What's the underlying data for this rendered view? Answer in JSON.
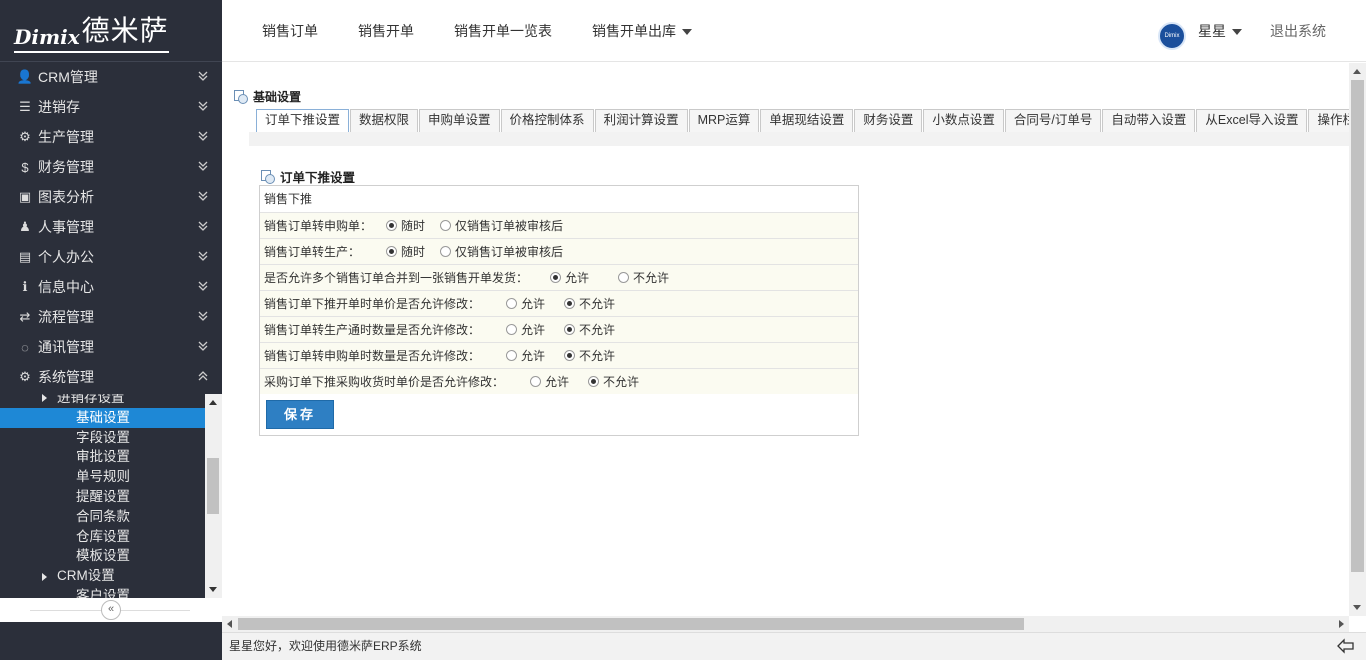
{
  "app": {
    "logo_latin": "Dimix",
    "logo_cn": "德米萨"
  },
  "sidebar": {
    "items": [
      {
        "label": "CRM管理",
        "icon": "user-icon",
        "glyph": "👤"
      },
      {
        "label": "进销存",
        "icon": "list-icon",
        "glyph": "☰"
      },
      {
        "label": "生产管理",
        "icon": "gears-icon",
        "glyph": "⚙"
      },
      {
        "label": "财务管理",
        "icon": "dollar-icon",
        "glyph": "$"
      },
      {
        "label": "图表分析",
        "icon": "picture-icon",
        "glyph": "▣"
      },
      {
        "label": "人事管理",
        "icon": "sitemap-icon",
        "glyph": "♟"
      },
      {
        "label": "个人办公",
        "icon": "briefcase-icon",
        "glyph": "▤"
      },
      {
        "label": "信息中心",
        "icon": "info-icon",
        "glyph": "ℹ"
      },
      {
        "label": "流程管理",
        "icon": "exchange-icon",
        "glyph": "⇄"
      },
      {
        "label": "通讯管理",
        "icon": "comment-icon",
        "glyph": "◌"
      },
      {
        "label": "系统管理",
        "icon": "cog-icon",
        "glyph": "⚙"
      }
    ],
    "submenu": [
      {
        "label": "进销存设置",
        "type": "group"
      },
      {
        "label": "基础设置",
        "type": "leaf",
        "selected": true
      },
      {
        "label": "字段设置",
        "type": "leaf"
      },
      {
        "label": "审批设置",
        "type": "leaf"
      },
      {
        "label": "单号规则",
        "type": "leaf"
      },
      {
        "label": "提醒设置",
        "type": "leaf"
      },
      {
        "label": "合同条款",
        "type": "leaf"
      },
      {
        "label": "仓库设置",
        "type": "leaf"
      },
      {
        "label": "模板设置",
        "type": "leaf"
      },
      {
        "label": "CRM设置",
        "type": "group"
      },
      {
        "label": "客户设置",
        "type": "leaf"
      }
    ],
    "collapse_label": "«"
  },
  "topnav": {
    "links": [
      "销售订单",
      "销售开单",
      "销售开单一览表",
      "销售开单出库"
    ],
    "user_name": "星星",
    "logout": "退出系统"
  },
  "content": {
    "breadcrumb": "基础设置",
    "tabs": [
      "订单下推设置",
      "数据权限",
      "申购单设置",
      "价格控制体系",
      "利润计算设置",
      "MRP运算",
      "单据现结设置",
      "财务设置",
      "小数点设置",
      "合同号/订单号",
      "自动带入设置",
      "从Excel导入设置",
      "操作栏"
    ],
    "active_tab": 0,
    "form_title": "订单下推设置",
    "section_header": "销售下推",
    "rows": [
      {
        "label": "销售订单转申购单：",
        "options": [
          "随时",
          "仅销售订单被审核后"
        ],
        "selected": 0
      },
      {
        "label": "销售订单转生产：",
        "options": [
          "随时",
          "仅销售订单被审核后"
        ],
        "selected": 0
      },
      {
        "label": "是否允许多个销售订单合并到一张销售开单发货：",
        "options": [
          "允许",
          "不允许"
        ],
        "selected": 0
      },
      {
        "label": "销售订单下推开单时单价是否允许修改：",
        "options": [
          "允许",
          "不允许"
        ],
        "selected": 1
      },
      {
        "label": "销售订单转生产通时数量是否允许修改：",
        "options": [
          "允许",
          "不允许"
        ],
        "selected": 1
      },
      {
        "label": "销售订单转申购单时数量是否允许修改：",
        "options": [
          "允许",
          "不允许"
        ],
        "selected": 1
      },
      {
        "label": "采购订单下推采购收货时单价是否允许修改：",
        "options": [
          "允许",
          "不允许"
        ],
        "selected": 1
      }
    ],
    "save_label": "保存"
  },
  "status": {
    "welcome": "星星您好，欢迎使用德米萨ERP系统"
  },
  "colors": {
    "sidebar_bg": "#2b2f3a",
    "selected_bg": "#1e88d6",
    "save_btn": "#2e7fc3"
  }
}
